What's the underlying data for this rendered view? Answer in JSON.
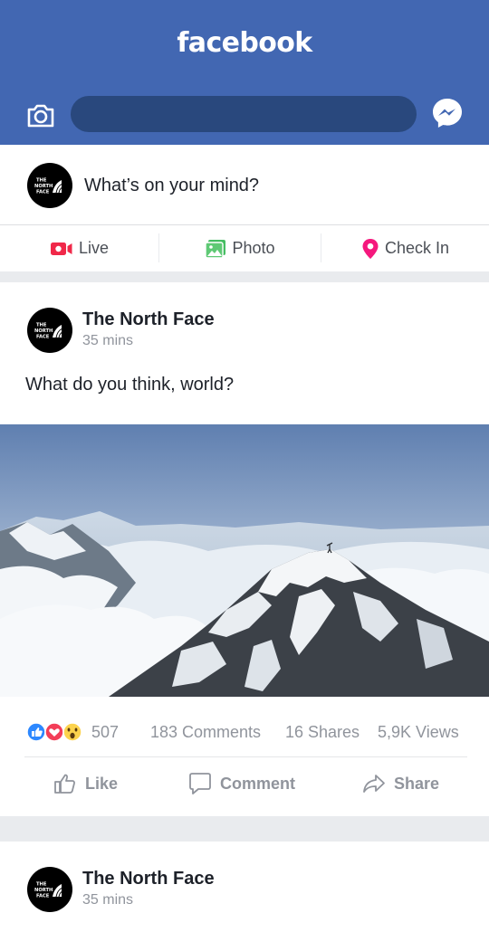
{
  "header": {
    "brand": "facebook",
    "camera_icon": "camera-icon",
    "messenger_icon": "messenger-icon",
    "search_value": ""
  },
  "composer": {
    "avatar": "the-north-face-logo",
    "placeholder": "What’s on your mind?",
    "actions": [
      {
        "label": "Live",
        "icon": "live-video-icon",
        "color": "#f02849"
      },
      {
        "label": "Photo",
        "icon": "photo-icon",
        "color": "#45bd62"
      },
      {
        "label": "Check In",
        "icon": "location-pin-icon",
        "color": "#f5187d"
      }
    ]
  },
  "posts": [
    {
      "author": "The North Face",
      "time": "35 mins",
      "text": "What do you think, world?",
      "photo": "snowy-mountain-peak-above-clouds",
      "reactions": [
        "like",
        "love",
        "wow"
      ],
      "reaction_count": "507",
      "comments": "183 Comments",
      "shares": "16 Shares",
      "views": "5,9K Views",
      "buttons": [
        "Like",
        "Comment",
        "Share"
      ]
    },
    {
      "author": "The North Face",
      "time": "35 mins"
    }
  ],
  "colors": {
    "brand_blue": "#4267b2",
    "search_bg": "#29487d",
    "muted_text": "#90949c",
    "feed_bg": "#e9ebee"
  }
}
